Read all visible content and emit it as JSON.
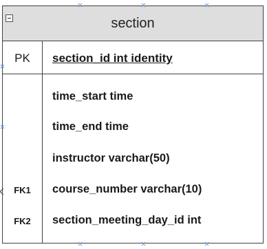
{
  "entity": {
    "title": "section",
    "primary_key": {
      "key_label": "PK",
      "field": "section_id int identity"
    },
    "attributes": [
      {
        "key_label": "",
        "field": "time_start time"
      },
      {
        "key_label": "",
        "field": "time_end time"
      },
      {
        "key_label": "",
        "field": "instructor varchar(50)"
      },
      {
        "key_label": "FK1",
        "field": "course_number varchar(10)"
      },
      {
        "key_label": "FK2",
        "field": "section_meeting_day_id int"
      }
    ]
  },
  "colors": {
    "header_fill": "#dedede",
    "border": "#404040",
    "connector_mark": "#6b9bd6"
  },
  "icons": [
    "collapse-minus-icon",
    "connector-point-icon"
  ]
}
